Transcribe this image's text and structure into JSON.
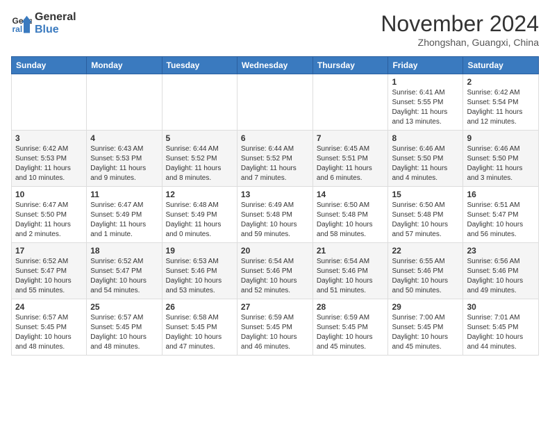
{
  "logo": {
    "line1": "General",
    "line2": "Blue"
  },
  "title": "November 2024",
  "location": "Zhongshan, Guangxi, China",
  "weekdays": [
    "Sunday",
    "Monday",
    "Tuesday",
    "Wednesday",
    "Thursday",
    "Friday",
    "Saturday"
  ],
  "weeks": [
    [
      {
        "day": "",
        "info": ""
      },
      {
        "day": "",
        "info": ""
      },
      {
        "day": "",
        "info": ""
      },
      {
        "day": "",
        "info": ""
      },
      {
        "day": "",
        "info": ""
      },
      {
        "day": "1",
        "info": "Sunrise: 6:41 AM\nSunset: 5:55 PM\nDaylight: 11 hours\nand 13 minutes."
      },
      {
        "day": "2",
        "info": "Sunrise: 6:42 AM\nSunset: 5:54 PM\nDaylight: 11 hours\nand 12 minutes."
      }
    ],
    [
      {
        "day": "3",
        "info": "Sunrise: 6:42 AM\nSunset: 5:53 PM\nDaylight: 11 hours\nand 10 minutes."
      },
      {
        "day": "4",
        "info": "Sunrise: 6:43 AM\nSunset: 5:53 PM\nDaylight: 11 hours\nand 9 minutes."
      },
      {
        "day": "5",
        "info": "Sunrise: 6:44 AM\nSunset: 5:52 PM\nDaylight: 11 hours\nand 8 minutes."
      },
      {
        "day": "6",
        "info": "Sunrise: 6:44 AM\nSunset: 5:52 PM\nDaylight: 11 hours\nand 7 minutes."
      },
      {
        "day": "7",
        "info": "Sunrise: 6:45 AM\nSunset: 5:51 PM\nDaylight: 11 hours\nand 6 minutes."
      },
      {
        "day": "8",
        "info": "Sunrise: 6:46 AM\nSunset: 5:50 PM\nDaylight: 11 hours\nand 4 minutes."
      },
      {
        "day": "9",
        "info": "Sunrise: 6:46 AM\nSunset: 5:50 PM\nDaylight: 11 hours\nand 3 minutes."
      }
    ],
    [
      {
        "day": "10",
        "info": "Sunrise: 6:47 AM\nSunset: 5:50 PM\nDaylight: 11 hours\nand 2 minutes."
      },
      {
        "day": "11",
        "info": "Sunrise: 6:47 AM\nSunset: 5:49 PM\nDaylight: 11 hours\nand 1 minute."
      },
      {
        "day": "12",
        "info": "Sunrise: 6:48 AM\nSunset: 5:49 PM\nDaylight: 11 hours\nand 0 minutes."
      },
      {
        "day": "13",
        "info": "Sunrise: 6:49 AM\nSunset: 5:48 PM\nDaylight: 10 hours\nand 59 minutes."
      },
      {
        "day": "14",
        "info": "Sunrise: 6:50 AM\nSunset: 5:48 PM\nDaylight: 10 hours\nand 58 minutes."
      },
      {
        "day": "15",
        "info": "Sunrise: 6:50 AM\nSunset: 5:48 PM\nDaylight: 10 hours\nand 57 minutes."
      },
      {
        "day": "16",
        "info": "Sunrise: 6:51 AM\nSunset: 5:47 PM\nDaylight: 10 hours\nand 56 minutes."
      }
    ],
    [
      {
        "day": "17",
        "info": "Sunrise: 6:52 AM\nSunset: 5:47 PM\nDaylight: 10 hours\nand 55 minutes."
      },
      {
        "day": "18",
        "info": "Sunrise: 6:52 AM\nSunset: 5:47 PM\nDaylight: 10 hours\nand 54 minutes."
      },
      {
        "day": "19",
        "info": "Sunrise: 6:53 AM\nSunset: 5:46 PM\nDaylight: 10 hours\nand 53 minutes."
      },
      {
        "day": "20",
        "info": "Sunrise: 6:54 AM\nSunset: 5:46 PM\nDaylight: 10 hours\nand 52 minutes."
      },
      {
        "day": "21",
        "info": "Sunrise: 6:54 AM\nSunset: 5:46 PM\nDaylight: 10 hours\nand 51 minutes."
      },
      {
        "day": "22",
        "info": "Sunrise: 6:55 AM\nSunset: 5:46 PM\nDaylight: 10 hours\nand 50 minutes."
      },
      {
        "day": "23",
        "info": "Sunrise: 6:56 AM\nSunset: 5:46 PM\nDaylight: 10 hours\nand 49 minutes."
      }
    ],
    [
      {
        "day": "24",
        "info": "Sunrise: 6:57 AM\nSunset: 5:45 PM\nDaylight: 10 hours\nand 48 minutes."
      },
      {
        "day": "25",
        "info": "Sunrise: 6:57 AM\nSunset: 5:45 PM\nDaylight: 10 hours\nand 48 minutes."
      },
      {
        "day": "26",
        "info": "Sunrise: 6:58 AM\nSunset: 5:45 PM\nDaylight: 10 hours\nand 47 minutes."
      },
      {
        "day": "27",
        "info": "Sunrise: 6:59 AM\nSunset: 5:45 PM\nDaylight: 10 hours\nand 46 minutes."
      },
      {
        "day": "28",
        "info": "Sunrise: 6:59 AM\nSunset: 5:45 PM\nDaylight: 10 hours\nand 45 minutes."
      },
      {
        "day": "29",
        "info": "Sunrise: 7:00 AM\nSunset: 5:45 PM\nDaylight: 10 hours\nand 45 minutes."
      },
      {
        "day": "30",
        "info": "Sunrise: 7:01 AM\nSunset: 5:45 PM\nDaylight: 10 hours\nand 44 minutes."
      }
    ]
  ]
}
